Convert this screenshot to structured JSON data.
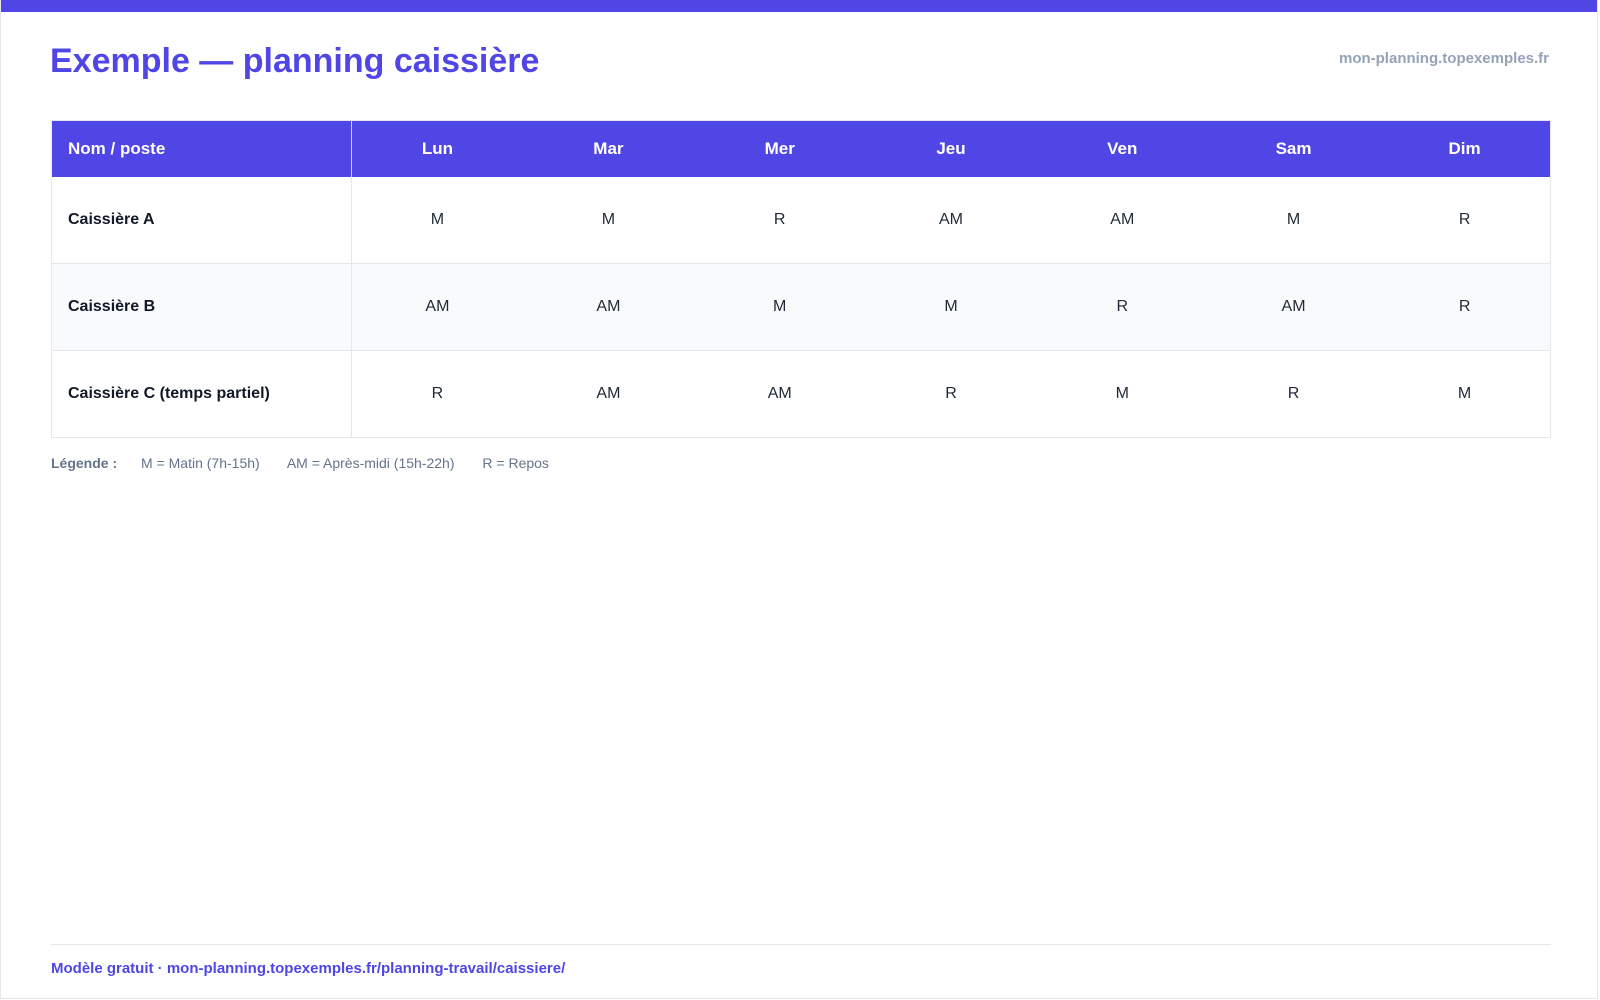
{
  "header": {
    "title": "Exemple — planning caissière",
    "site": "mon-planning.topexemples.fr"
  },
  "table": {
    "name_header": "Nom / poste",
    "days": [
      "Lun",
      "Mar",
      "Mer",
      "Jeu",
      "Ven",
      "Sam",
      "Dim"
    ],
    "rows": [
      {
        "name": "Caissière A",
        "shifts": [
          "M",
          "M",
          "R",
          "AM",
          "AM",
          "M",
          "R"
        ]
      },
      {
        "name": "Caissière B",
        "shifts": [
          "AM",
          "AM",
          "M",
          "M",
          "R",
          "AM",
          "R"
        ]
      },
      {
        "name": "Caissière C (temps partiel)",
        "shifts": [
          "R",
          "AM",
          "AM",
          "R",
          "M",
          "R",
          "M"
        ]
      }
    ]
  },
  "legend": {
    "title": "Légende :",
    "items": [
      "M = Matin (7h-15h)",
      "AM = Après-midi (15h-22h)",
      "R = Repos"
    ]
  },
  "footer": {
    "text": "Modèle gratuit · mon-planning.topexemples.fr/planning-travail/caissiere/"
  },
  "colors": {
    "accent": "#4f46e5",
    "muted": "#94a3b8",
    "row_alt": "#f8fafc"
  }
}
